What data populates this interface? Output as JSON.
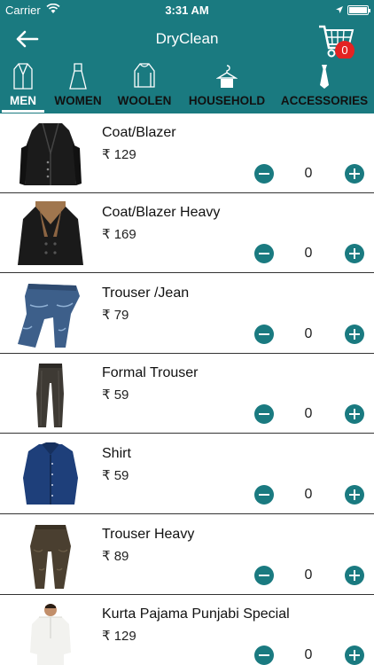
{
  "status_bar": {
    "carrier": "Carrier",
    "time": "3:31 AM"
  },
  "header": {
    "title": "DryClean",
    "cart_count": "0"
  },
  "tabs": [
    {
      "label": "MEN",
      "icon": "blazer-icon",
      "active": true
    },
    {
      "label": "WOMEN",
      "icon": "dress-icon",
      "active": false
    },
    {
      "label": "WOOLEN",
      "icon": "sweater-icon",
      "active": false
    },
    {
      "label": "HOUSEHOLD",
      "icon": "hanger-icon",
      "active": false
    },
    {
      "label": "ACCESSORIES",
      "icon": "tie-icon",
      "active": false
    }
  ],
  "items": [
    {
      "name": "Coat/Blazer",
      "price": "₹ 129",
      "qty": "0",
      "image": "blazer"
    },
    {
      "name": "Coat/Blazer Heavy",
      "price": "₹ 169",
      "qty": "0",
      "image": "heavy-coat"
    },
    {
      "name": "Trouser /Jean",
      "price": "₹ 79",
      "qty": "0",
      "image": "jeans"
    },
    {
      "name": "Formal Trouser",
      "price": "₹ 59",
      "qty": "0",
      "image": "formal-trouser"
    },
    {
      "name": "Shirt",
      "price": "₹ 59",
      "qty": "0",
      "image": "shirt"
    },
    {
      "name": "Trouser Heavy",
      "price": "₹ 89",
      "qty": "0",
      "image": "heavy-trouser"
    },
    {
      "name": "Kurta Pajama Punjabi Special",
      "price": "₹ 129",
      "qty": "0",
      "image": "kurta"
    }
  ],
  "colors": {
    "primary": "#1a7a80",
    "badge": "#e32222"
  }
}
